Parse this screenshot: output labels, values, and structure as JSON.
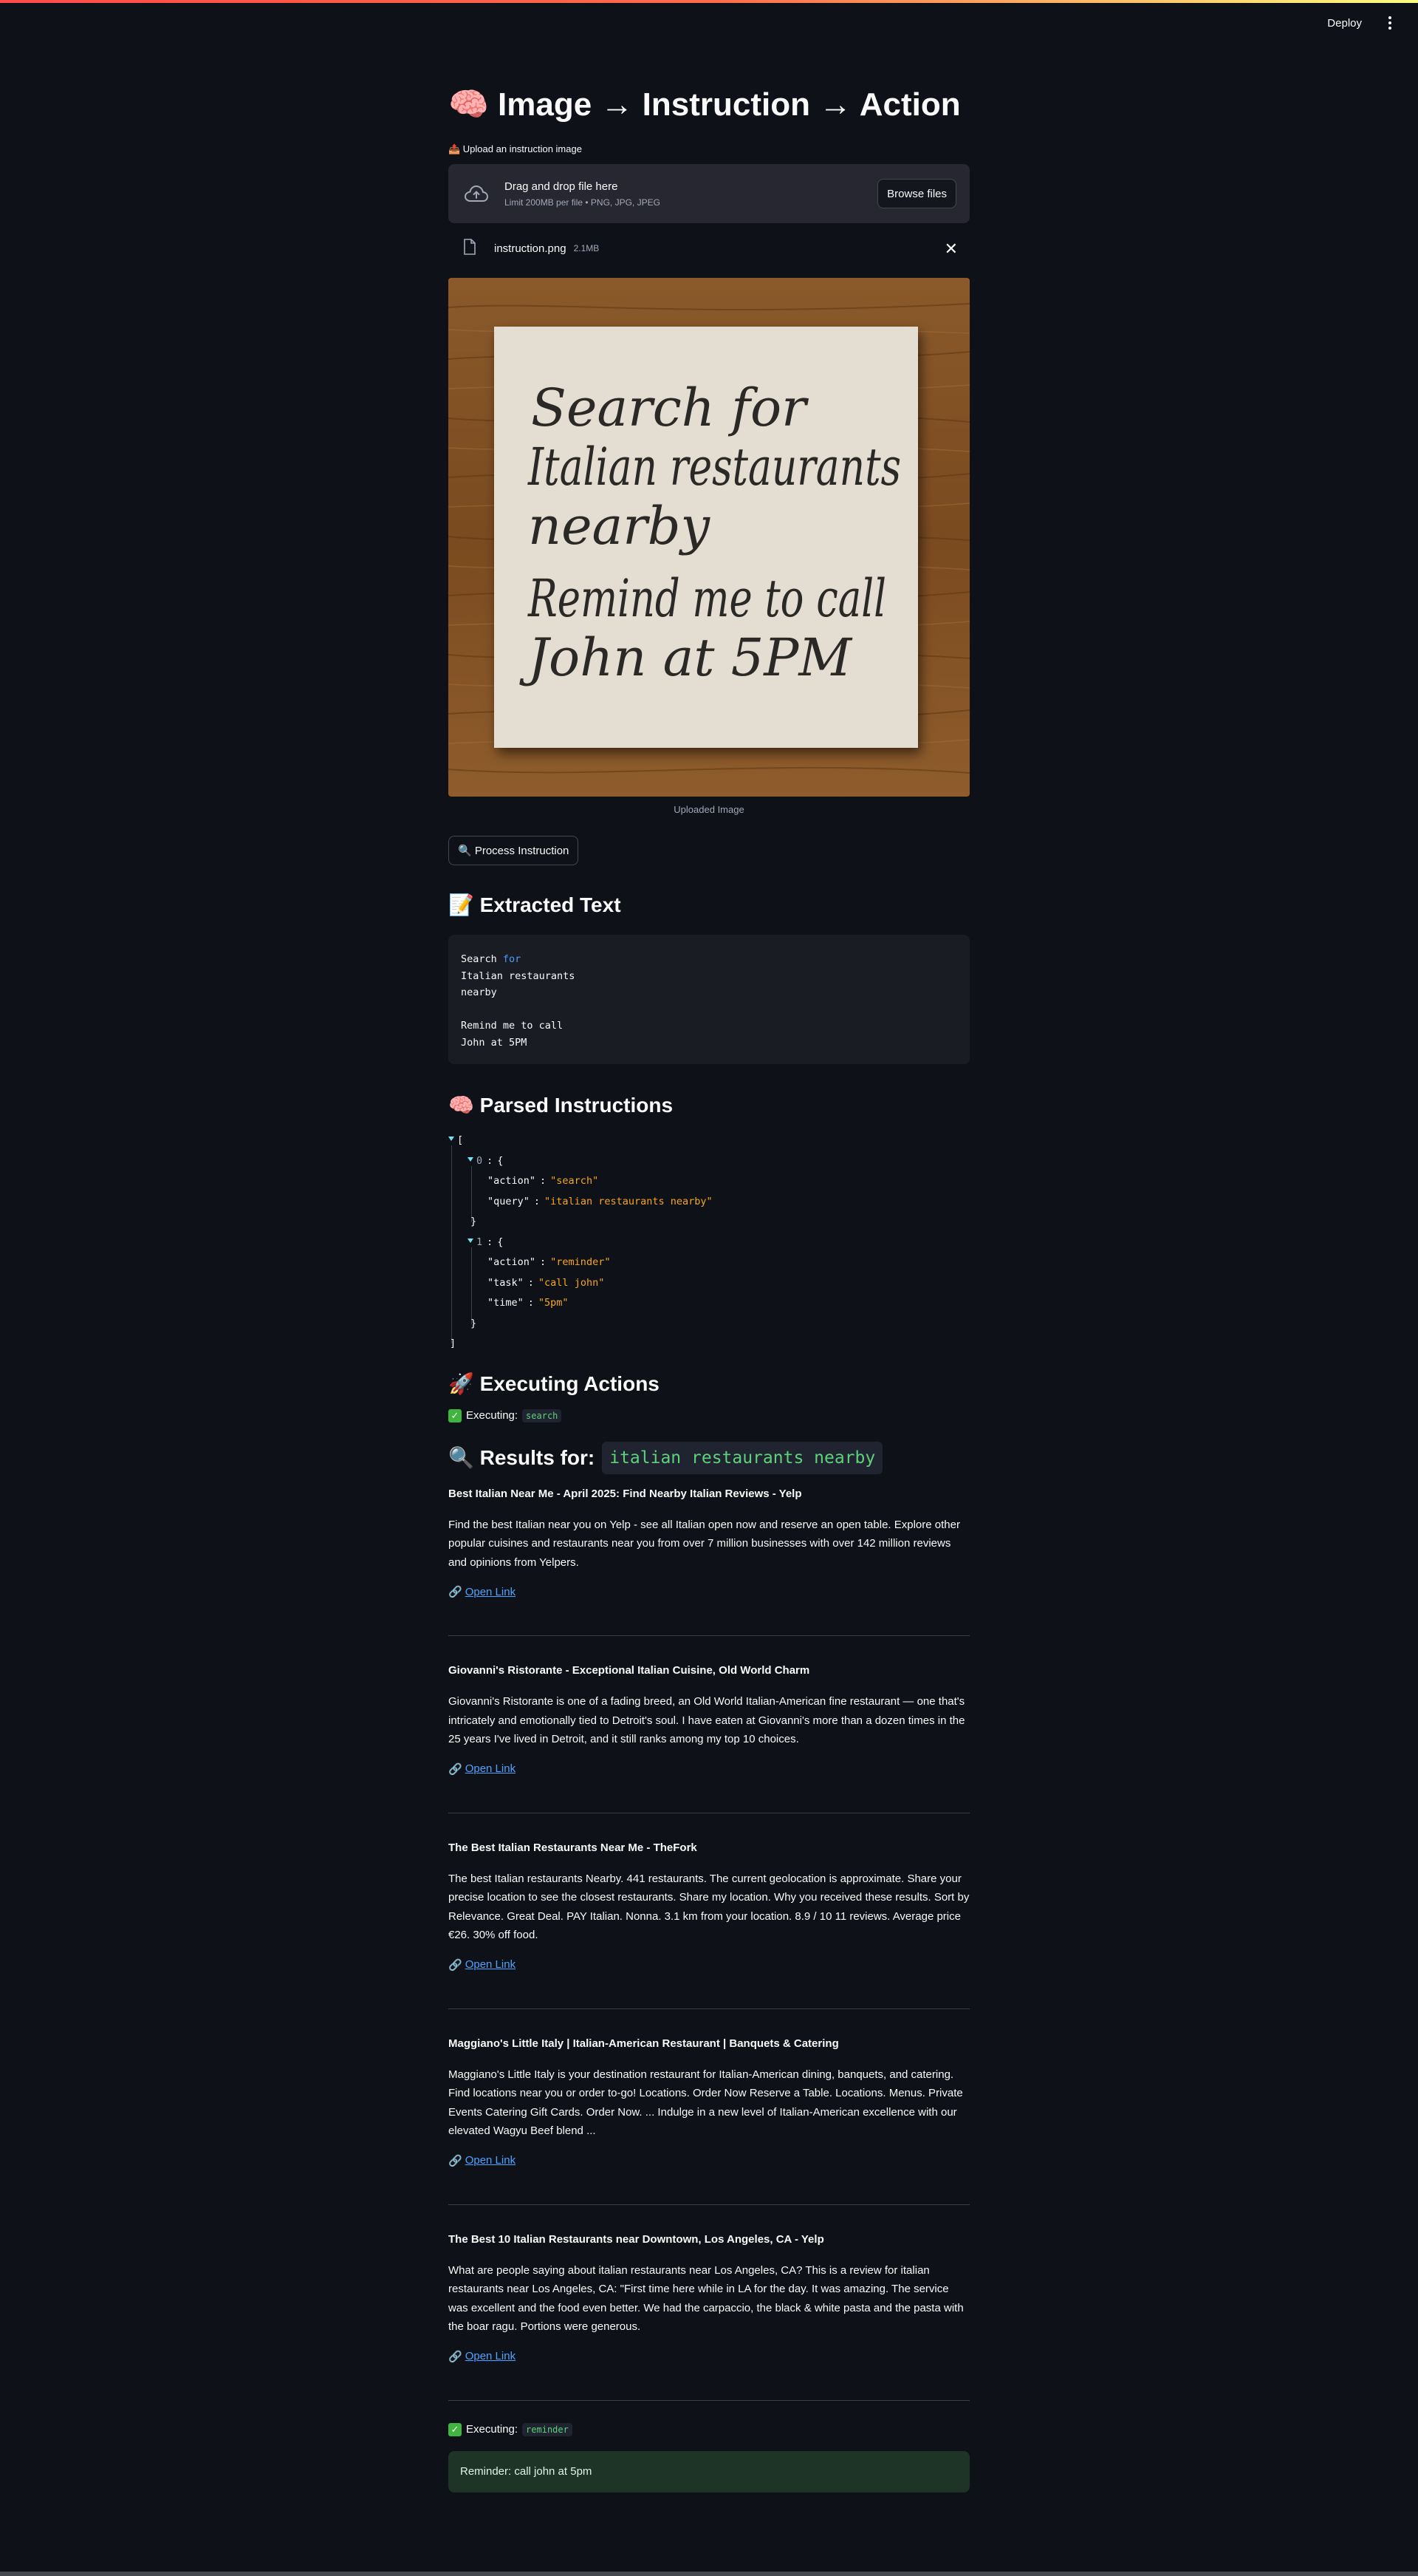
{
  "topbar": {
    "deploy_label": "Deploy"
  },
  "page": {
    "title": "🧠 Image → Instruction → Action"
  },
  "upload": {
    "label": "📤 Upload an instruction image",
    "drag_text": "Drag and drop file here",
    "limit_text": "Limit 200MB per file • PNG, JPG, JPEG",
    "browse_label": "Browse files",
    "file_name": "instruction.png",
    "file_size": "2.1MB",
    "close_glyph": "✕"
  },
  "image": {
    "note_lines": [
      "Search for",
      "Italian restaurants",
      "nearby",
      "Remind me to call",
      "John at 5PM"
    ],
    "caption": "Uploaded Image"
  },
  "process_button": {
    "label": "🔍 Process Instruction"
  },
  "extracted": {
    "heading": "📝 Extracted Text",
    "lines": [
      "Search for",
      "Italian restaurants",
      "nearby",
      "",
      "Remind me to call",
      "John at 5PM"
    ]
  },
  "parsed": {
    "heading": "🧠 Parsed Instructions",
    "items": [
      {
        "index": "0",
        "entries": [
          {
            "key": "\"action\"",
            "value": "\"search\""
          },
          {
            "key": "\"query\"",
            "value": "\"italian restaurants nearby\""
          }
        ]
      },
      {
        "index": "1",
        "entries": [
          {
            "key": "\"action\"",
            "value": "\"reminder\""
          },
          {
            "key": "\"task\"",
            "value": "\"call john\""
          },
          {
            "key": "\"time\"",
            "value": "\"5pm\""
          }
        ]
      }
    ]
  },
  "executing": {
    "heading": "🚀 Executing Actions",
    "prefix": "Executing:",
    "first_action": "search",
    "second_action": "reminder"
  },
  "results": {
    "heading_prefix": "🔍 Results for:",
    "query": "italian restaurants nearby",
    "link_label": "Open Link",
    "items": [
      {
        "title": "Best Italian Near Me - April 2025: Find Nearby Italian Reviews - Yelp",
        "desc": "Find the best Italian near you on Yelp - see all Italian open now and reserve an open table. Explore other popular cuisines and restaurants near you from over 7 million businesses with over 142 million reviews and opinions from Yelpers."
      },
      {
        "title": "Giovanni's Ristorante - Exceptional Italian Cuisine, Old World Charm",
        "desc": "Giovanni's Ristorante is one of a fading breed, an Old World Italian-American fine restaurant — one that's intricately and emotionally tied to Detroit's soul. I have eaten at Giovanni's more than a dozen times in the 25 years I've lived in Detroit, and it still ranks among my top 10 choices."
      },
      {
        "title": "The Best Italian Restaurants Near Me - TheFork",
        "desc": "The best Italian restaurants Nearby. 441 restaurants. The current geolocation is approximate. Share your precise location to see the closest restaurants. Share my location. Why you received these results. Sort by Relevance. Great Deal. PAY Italian. Nonna. 3.1 km from your location. 8.9 / 10 11 reviews. Average price €26. 30% off food."
      },
      {
        "title": "Maggiano's Little Italy | Italian-American Restaurant | Banquets & Catering",
        "desc": "Maggiano's Little Italy is your destination restaurant for Italian-American dining, banquets, and catering. Find locations near you or order to-go! Locations. Order Now Reserve a Table. Locations. Menus. Private Events Catering Gift Cards. Order Now. ... Indulge in a new level of Italian-American excellence with our elevated Wagyu Beef blend ..."
      },
      {
        "title": "The Best 10 Italian Restaurants near Downtown, Los Angeles, CA - Yelp",
        "desc": "What are people saying about italian restaurants near Los Angeles, CA? This is a review for italian restaurants near Los Angeles, CA: \"First time here while in LA for the day. It was amazing. The service was excellent and the food even better. We had the carpaccio, the black & white pasta and the pasta with the boar ragu. Portions were generous."
      }
    ]
  },
  "reminder": {
    "text": "Reminder: call john at 5pm"
  },
  "colors": {
    "background": "#0e1117",
    "accent": "#ff4b4b",
    "link": "#4da3ff",
    "code_green": "#5fd17a",
    "json_string": "#f5a623"
  },
  "icons": [
    "cloud-upload-icon",
    "file-icon",
    "close-icon",
    "more-vert-icon",
    "check-icon",
    "link-icon"
  ]
}
